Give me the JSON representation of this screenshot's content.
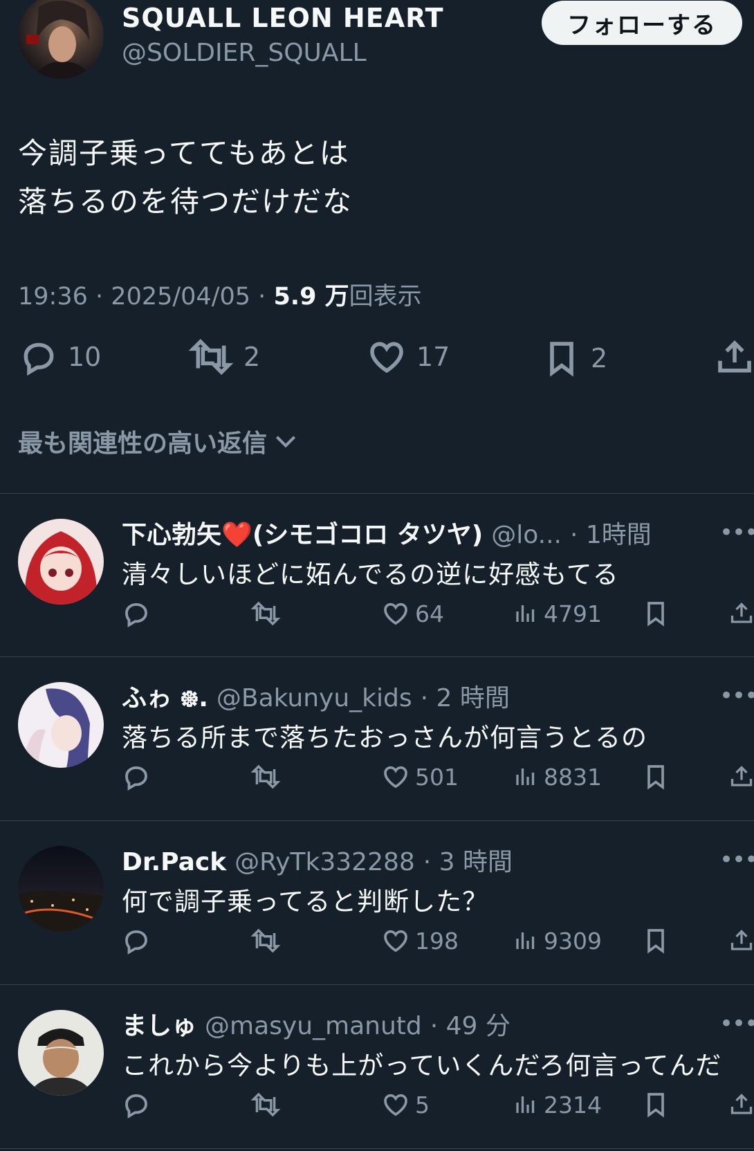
{
  "tweet": {
    "author_name": "SQUALL LEON HEART",
    "author_handle": "@SOLDIER_SQUALL",
    "follow_label": "フォローする",
    "text_lines": [
      "今調子乗っててもあとは",
      "落ちるのを待つだけだな"
    ],
    "time": "19:36",
    "date": "2025/04/05",
    "views_count": "5.9 万",
    "views_label": "回表示",
    "separator": "·",
    "stats": {
      "replies": "10",
      "retweets": "2",
      "likes": "17",
      "bookmarks": "2"
    }
  },
  "sort_label": "最も関連性の高い返信",
  "replies": [
    {
      "name": "下心勃矢❤️(シモゴコロ タツヤ)",
      "handle": "@lo...",
      "time": "· 1時間",
      "text": "清々しいほどに妬んでるの逆に好感もてる",
      "likes": "64",
      "views": "4791"
    },
    {
      "name": "ふゎ ᪥.",
      "handle": "@Bakunyu_kids",
      "time": "· 2 時間",
      "text": "落ちる所まで落ちたおっさんが何言うとるの",
      "likes": "501",
      "views": "8831"
    },
    {
      "name": "Dr.Pack",
      "handle": "@RyTk332288",
      "time": "· 3 時間",
      "text": "何で調子乗ってると判断した？",
      "likes": "198",
      "views": "9309"
    },
    {
      "name": "ましゅ",
      "handle": "@masyu_manutd",
      "time": "· 49 分",
      "text": "これから今よりも上がっていくんだろ何言ってんだ",
      "likes": "5",
      "views": "2314"
    }
  ],
  "more_label": "•••",
  "icons": [
    "reply-icon",
    "retweet-icon",
    "like-icon",
    "bookmark-icon",
    "share-icon",
    "views-icon",
    "chevron-down-icon",
    "more-icon"
  ],
  "colors": {
    "background": "#15202b",
    "text": "#f7f9f9",
    "secondary": "#8b98a5",
    "divider": "#38444d",
    "follow_bg": "#eff3f4"
  }
}
